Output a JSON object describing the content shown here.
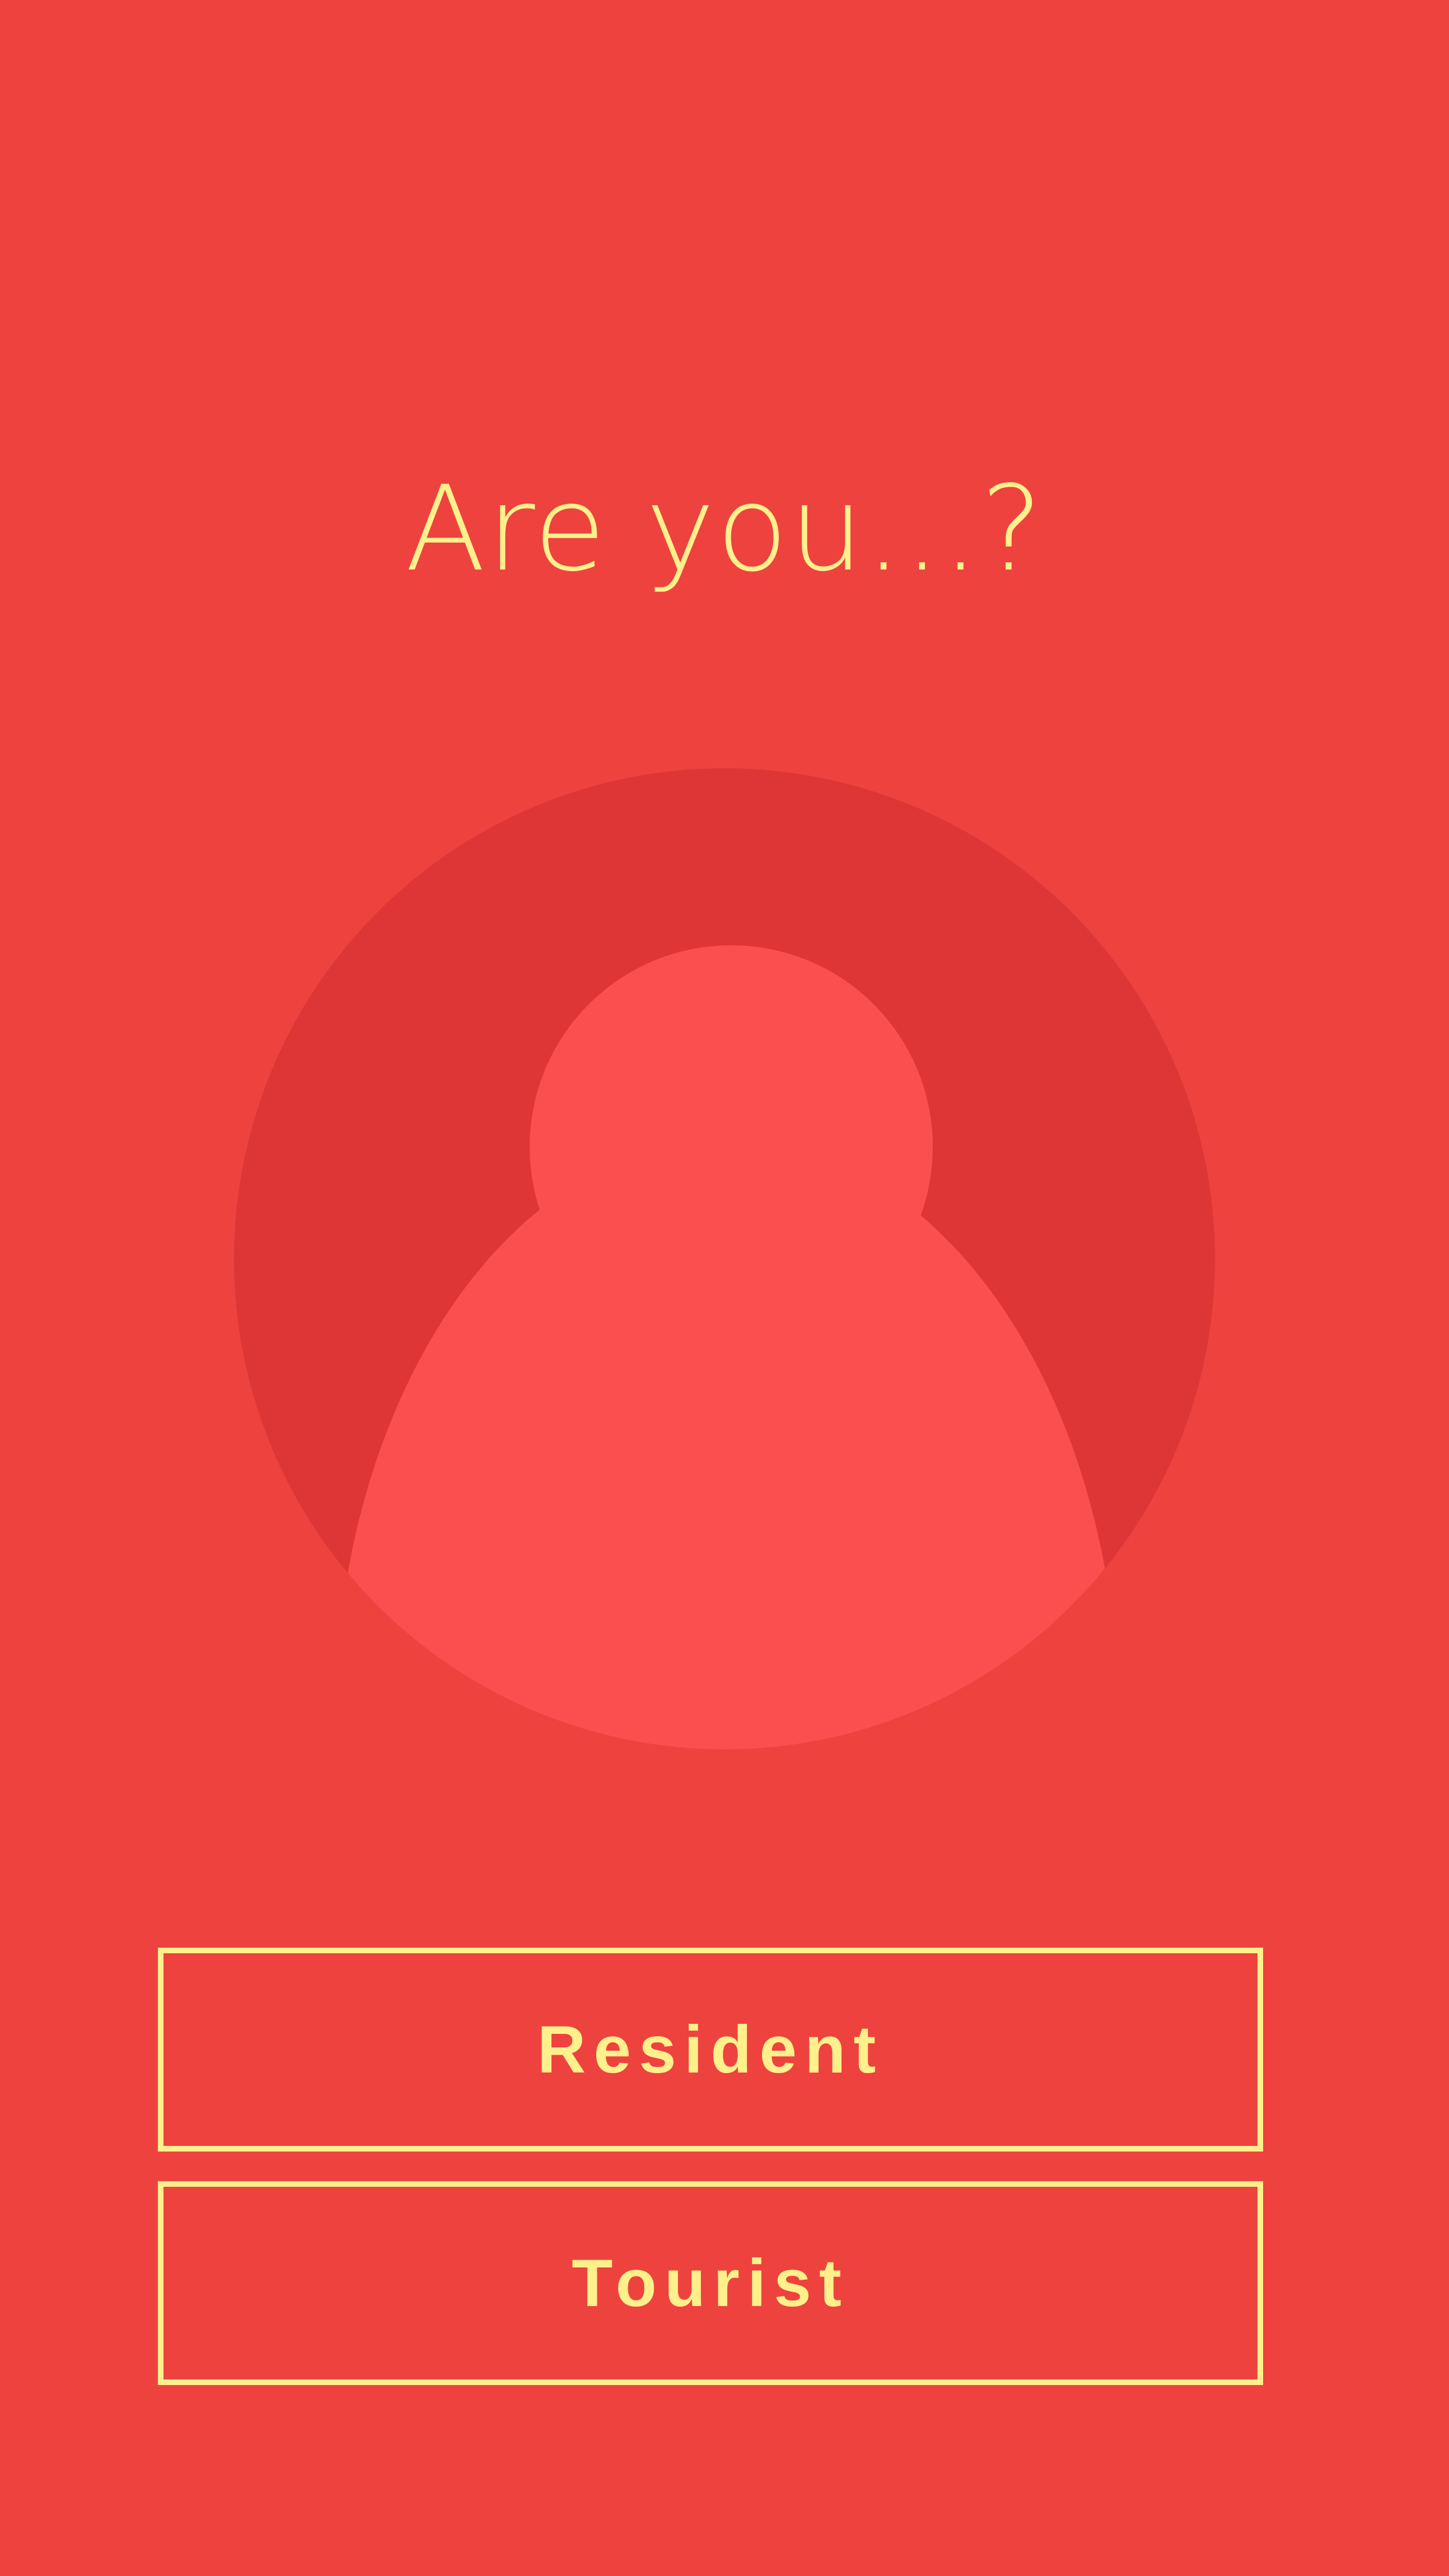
{
  "screen": {
    "title": "Are you...?",
    "avatar_icon": "person-silhouette-icon"
  },
  "options": [
    {
      "label": "Resident"
    },
    {
      "label": "Tourist"
    }
  ],
  "colors": {
    "background": "#EE423F",
    "text_accent": "#FFF08C",
    "avatar_circle": "#DE3636",
    "avatar_figure": "#FA4F4F"
  }
}
